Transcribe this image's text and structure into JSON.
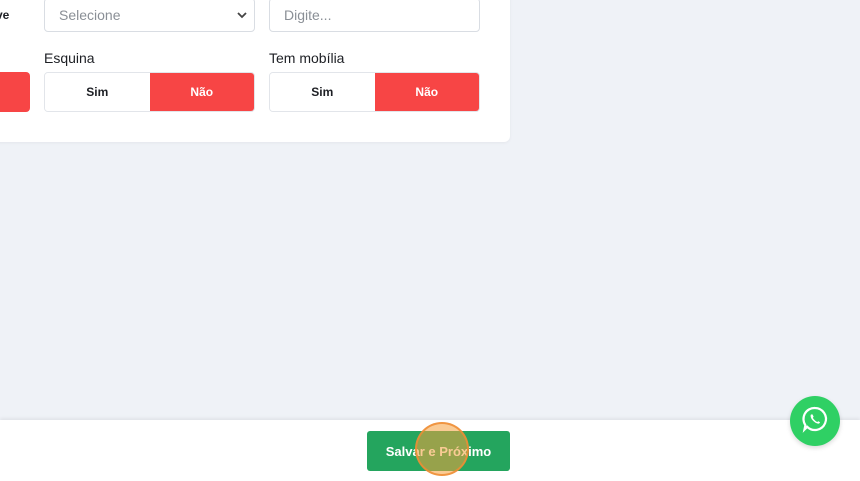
{
  "form": {
    "partial_toggle_text": "ve",
    "select_placeholder": "Selecione",
    "input_placeholder": "Digite...",
    "esquina": {
      "label": "Esquina",
      "options": [
        "Sim",
        "Não"
      ],
      "selected": "Não"
    },
    "tem_mobilia": {
      "label": "Tem mobília",
      "options": [
        "Sim",
        "Não"
      ],
      "selected": "Não"
    }
  },
  "footer": {
    "save_next_label": "Salvar e Próximo"
  },
  "colors": {
    "active_option": "#f74545",
    "save_button": "#24a55e",
    "whatsapp": "#2fd064",
    "background": "#eff2f7"
  },
  "icons": {
    "whatsapp": "whatsapp-icon",
    "select": "chevron-down-icon"
  }
}
